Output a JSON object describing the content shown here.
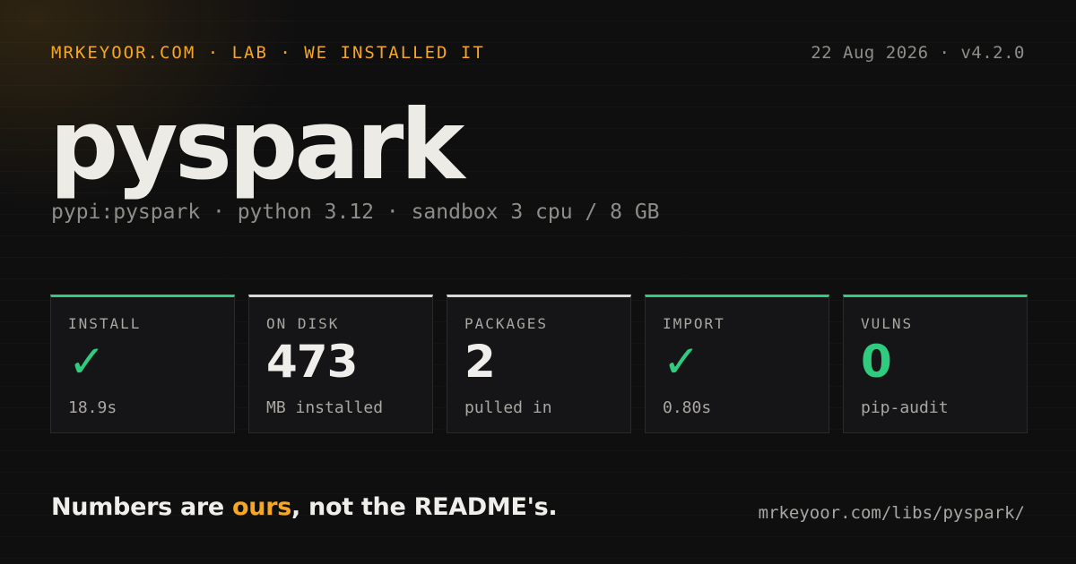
{
  "header": {
    "kicker": "MRKEYOOR.COM · LAB · WE INSTALLED IT",
    "meta": "22 Aug 2026 · v4.2.0"
  },
  "title": "pyspark",
  "subtitle": "pypi:pyspark · python 3.12 · sandbox 3 cpu / 8 GB",
  "cards": [
    {
      "label": "INSTALL",
      "value": "✓",
      "sub": "18.9s",
      "status": "ok"
    },
    {
      "label": "ON DISK",
      "value": "473",
      "sub": "MB installed",
      "status": "neutral"
    },
    {
      "label": "PACKAGES",
      "value": "2",
      "sub": "pulled in",
      "status": "neutral"
    },
    {
      "label": "IMPORT",
      "value": "✓",
      "sub": "0.80s",
      "status": "ok"
    },
    {
      "label": "VULNS",
      "value": "0",
      "sub": "pip-audit",
      "status": "ok"
    }
  ],
  "tagline": {
    "before": "Numbers are ",
    "accent": "ours",
    "after": ", not the README's."
  },
  "url": "mrkeyoor.com/libs/pyspark/",
  "colors": {
    "accent": "#f5a623",
    "ok": "#2fcc7f",
    "neutral": "#d8d8d8",
    "background": "#0f0f10"
  }
}
